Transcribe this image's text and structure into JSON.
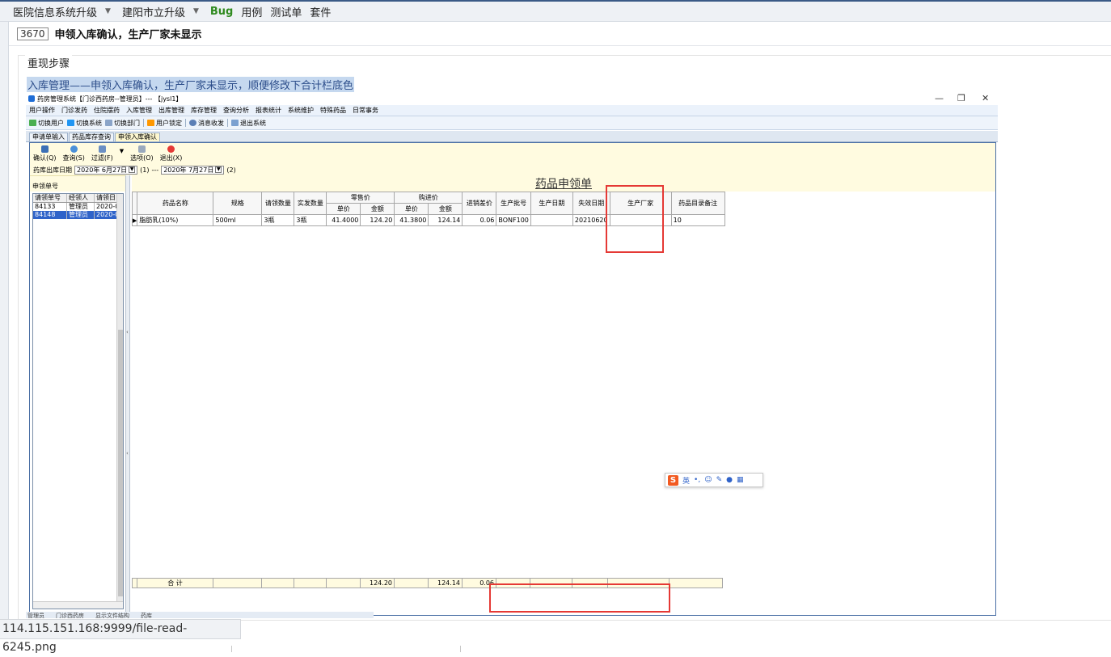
{
  "top_nav": {
    "item1": "医院信息系统升级",
    "item2": "建阳市立升级",
    "bug": "Bug",
    "case": "用例",
    "testsheet": "测试单",
    "suite": "套件"
  },
  "bug": {
    "id": "3670",
    "title": "申领入库确认，生产厂家未显示"
  },
  "steps": {
    "heading": "重现步骤",
    "text": "入库管理——申领入库确认，生产厂家未显示，顺便修改下合计栏底色"
  },
  "app": {
    "window_title": "药房管理系统【门诊西药房--管理员】--- 【jysl1】",
    "menu": [
      "用户操作",
      "门诊发药",
      "住院摆药",
      "入库管理",
      "出库管理",
      "库存管理",
      "查询分析",
      "报表统计",
      "系统维护",
      "特殊药品",
      "日常事务"
    ],
    "toolbar": [
      "切换用户",
      "切换系统",
      "切换部门",
      "用户锁定",
      "消息收发",
      "退出系统"
    ],
    "tabs": [
      "申请单输入",
      "药品库存查询",
      "申领入库确认"
    ],
    "buttons": [
      "确认(Q)",
      "查询(S)",
      "过滤(F)",
      "选项(O)",
      "退出(X)"
    ],
    "date_label": "药库出库日期",
    "date_from": "2020年 6月27日",
    "date_from_suffix": "(1)",
    "date_sep": "---",
    "date_to": "2020年 7月27日",
    "date_to_suffix": "(2)",
    "left_header": "申领单号",
    "left_columns": [
      "请领单号",
      "经领人",
      "请领日"
    ],
    "left_rows": [
      {
        "id": "84133",
        "person": "管理员",
        "date": "2020-0"
      },
      {
        "id": "84148",
        "person": "管理员",
        "date": "2020-0"
      }
    ],
    "doc_title": "药品申领单",
    "grid_headers": {
      "name": "药品名称",
      "spec": "规格",
      "req_qty": "请领数量",
      "actual_qty": "实发数量",
      "retail": "零售价",
      "purchase": "购进价",
      "unit_price": "单价",
      "amount": "金额",
      "diff": "进销差价",
      "batch": "生产批号",
      "mfg_date": "生产日期",
      "exp_date": "失效日期",
      "maker": "生产厂家",
      "note": "药品目录备注"
    },
    "rows": [
      {
        "name": "脂肪乳(10%)",
        "spec": "500ml",
        "req_qty": "3瓶",
        "actual_qty": "3瓶",
        "retail_price": "41.4000",
        "retail_amount": "124.20",
        "purchase_price": "41.3800",
        "purchase_amount": "124.14",
        "diff": "0.06",
        "batch": "BONF100",
        "mfg_date": "",
        "exp_date": "20210620",
        "maker": "",
        "note": "10"
      }
    ],
    "totals": {
      "label": "合  计",
      "retail_amount": "124.20",
      "purchase_amount": "124.14",
      "diff": "0.06"
    },
    "ime_lang": "英",
    "statusbar": [
      "管理员",
      "门诊西药房",
      "显示文件结构",
      "药库"
    ]
  },
  "browser": {
    "url": "114.115.151.168:9999/file-read-6245.png"
  },
  "colors": {
    "accent": "#2f63c9",
    "bug_green": "#2f8a1f",
    "annotation_red": "#e53935",
    "pale_yellow": "#fffbe0"
  }
}
